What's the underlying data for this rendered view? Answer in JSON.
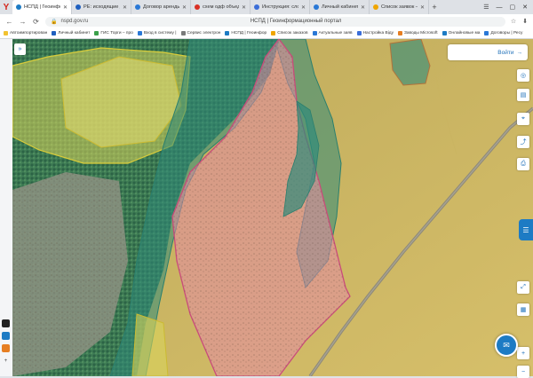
{
  "browser": {
    "brand_glyph": "Y",
    "tabs": [
      {
        "label": "НСПД | Геоинформацио",
        "active": true,
        "color": "#1d7bc4"
      },
      {
        "label": "РЕ: исходящие документ",
        "active": false,
        "color": "#1f5fbf"
      },
      {
        "label": "Договор аренды ленинг",
        "active": false,
        "color": "#2a78d6"
      },
      {
        "label": "схем одф объединить",
        "active": false,
        "color": "#d93025"
      },
      {
        "label": "Инструкция: сложные КЗГ",
        "active": false,
        "color": "#3b6ed8"
      },
      {
        "label": "Личный кабинет",
        "active": false,
        "color": "#2a78d6"
      },
      {
        "label": "Список заявок — Теоно ( ",
        "active": false,
        "color": "#f0a500"
      }
    ],
    "new_tab": "+",
    "window_controls": [
      "☰",
      "—",
      "▢",
      "✕"
    ],
    "url_host": "nspd.gov.ru",
    "url_title": "НСПД | Геоинформационный портал",
    "nav": {
      "back": "←",
      "forward": "→",
      "reload": "⟳"
    }
  },
  "bookmarks": [
    {
      "label": "Автоимпортирован",
      "color": "#f2c230"
    },
    {
      "label": "Личный кабинет",
      "color": "#1f5fbf"
    },
    {
      "label": "ГИС Торги – про",
      "color": "#3aa04a"
    },
    {
      "label": "Вход в систему |",
      "color": "#2a78d6"
    },
    {
      "label": "Сервис электрон",
      "color": "#7a7a7a"
    },
    {
      "label": "НСПД | Геоинфор",
      "color": "#1d7bc4"
    },
    {
      "label": "Список заказов",
      "color": "#f0a500"
    },
    {
      "label": "Актуальные заяв",
      "color": "#2a78d6"
    },
    {
      "label": "Настройка Віду",
      "color": "#3b6ed8"
    },
    {
      "label": "Заводы Microsoft",
      "color": "#e67e22"
    },
    {
      "label": "Онлайновые ма",
      "color": "#1d7bc4"
    },
    {
      "label": "Договоры | Ресу",
      "color": "#2a78d6"
    }
  ],
  "portal": {
    "burger_glyph": "»",
    "login_label": "Войти",
    "login_icon": "→"
  },
  "toolbar": [
    {
      "name": "location-icon",
      "glyph": "◎"
    },
    {
      "name": "layers-icon",
      "glyph": "▤"
    },
    {
      "name": "measure-icon",
      "glyph": "⌖"
    },
    {
      "name": "share-icon",
      "glyph": "⤴"
    },
    {
      "name": "print-icon",
      "glyph": "⎙"
    },
    {
      "name": "fullscreen-icon",
      "glyph": "⤢"
    },
    {
      "name": "ruler-icon",
      "glyph": "▦"
    },
    {
      "name": "zoom-in-icon",
      "glyph": "+"
    },
    {
      "name": "zoom-out-icon",
      "glyph": "−"
    }
  ],
  "chat": {
    "side_glyph": "☰",
    "bubble_glyph": "✉"
  },
  "colors": {
    "parcel_yellow": "#e8d44a",
    "parcel_pink": "#e68aa6",
    "forest_teal": "#2f8a7a",
    "accent": "#1d7bc4"
  }
}
